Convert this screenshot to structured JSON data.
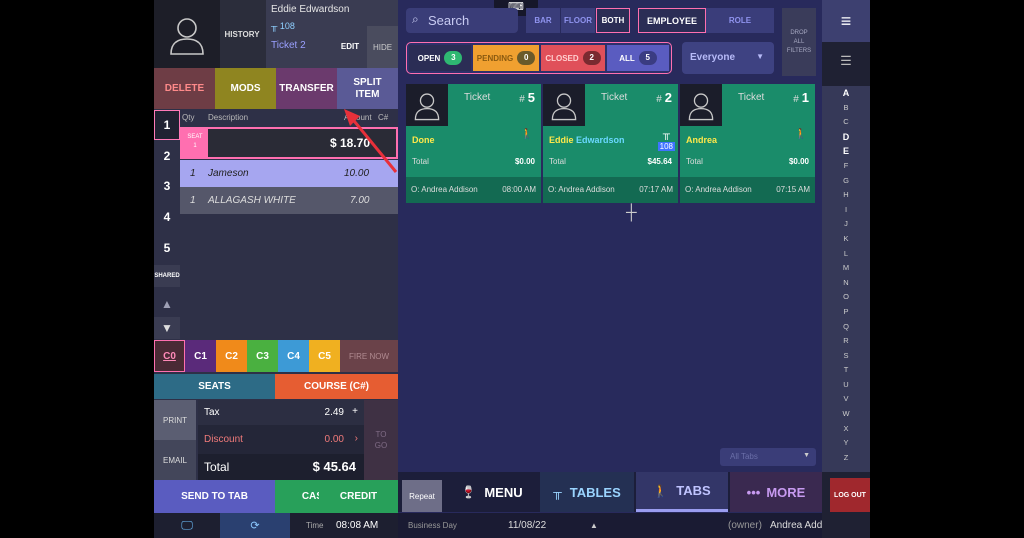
{
  "customer": {
    "history_label": "HISTORY",
    "name": "Eddie Edwardson",
    "table": "108",
    "ticket": "Ticket 2",
    "edit_label": "EDIT",
    "hide_label": "HIDE"
  },
  "actions": {
    "delete": "DELETE",
    "mods": "MODS",
    "transfer": "TRANSFER",
    "split_line1": "SPLIT",
    "split_line2": "ITEM"
  },
  "seats": [
    "1",
    "2",
    "3",
    "4",
    "5"
  ],
  "shared_label": "SHARED",
  "order_header": {
    "qty": "Qty",
    "description": "Description",
    "amount": "Amount",
    "course": "C#"
  },
  "seat_row": {
    "tag_line1": "SEAT",
    "tag_line2": "1",
    "total": "$ 18.70"
  },
  "items": [
    {
      "qty": "1",
      "name": "Jameson",
      "price": "10.00"
    },
    {
      "qty": "1",
      "name": "ALLAGASH WHITE",
      "price": "7.00"
    }
  ],
  "courses": [
    "C0",
    "C1",
    "C2",
    "C3",
    "C4",
    "C5"
  ],
  "course_colors": [
    "#2e3047",
    "#5a2a7a",
    "#f08a1a",
    "#4ab040",
    "#3d9ad6",
    "#f0b020"
  ],
  "fire_label": "FIRE NOW",
  "seats_btn": "SEATS",
  "course_btn": "COURSE (C#)",
  "print_label": "PRINT",
  "email_label": "EMAIL",
  "totals": {
    "tax_label": "Tax",
    "tax_value": "2.49",
    "discount_label": "Discount",
    "discount_value": "0.00",
    "total_label": "Total",
    "total_value": "$ 45.64"
  },
  "togo_line1": "TO",
  "togo_line2": "GO",
  "bottom_actions": {
    "send": "SEND TO TAB",
    "cash": "CASH",
    "credit": "CREDIT"
  },
  "status": {
    "time_label": "Time",
    "time_value": "08:08 AM"
  },
  "search": {
    "placeholder": "Search"
  },
  "area_filters": [
    "BAR",
    "FLOOR",
    "BOTH"
  ],
  "view_filters": [
    "EMPLOYEE",
    "ROLE"
  ],
  "drop_filters": {
    "l1": "DROP",
    "l2": "ALL",
    "l3": "FILTERS"
  },
  "status_filters": [
    {
      "label": "OPEN",
      "count": "3",
      "color": "#2fb872"
    },
    {
      "label": "PENDING",
      "count": "0",
      "color": "#6a5a2a"
    },
    {
      "label": "CLOSED",
      "count": "2",
      "color": "#7a2a30"
    },
    {
      "label": "ALL",
      "count": "5",
      "color": "#3a3c82"
    }
  ],
  "everyone_select": "Everyone",
  "tickets": [
    {
      "label": "Ticket",
      "num_prefix": "#",
      "number": "5",
      "name": "Done",
      "total_label": "Total",
      "total": "$0.00",
      "owner": "O: Andrea Addison",
      "time": "08:00 AM",
      "table": ""
    },
    {
      "label": "Ticket",
      "num_prefix": "#",
      "number": "2",
      "name": "Eddie Edwardson",
      "total_label": "Total",
      "total": "$45.64",
      "owner": "O: Andrea Addison",
      "time": "07:17 AM",
      "table": "108"
    },
    {
      "label": "Ticket",
      "num_prefix": "#",
      "number": "1",
      "name": "Andrea",
      "total_label": "Total",
      "total": "$0.00",
      "owner": "O: Andrea Addison",
      "time": "07:15 AM",
      "table": ""
    }
  ],
  "all_tabs": "All Tabs",
  "nav": {
    "repeat": "Repeat",
    "menu": "MENU",
    "tables": "TABLES",
    "tabs": "TABS",
    "more": "MORE"
  },
  "bizbar": {
    "label": "Business Day",
    "date": "11/08/22",
    "owner_label": "(owner)",
    "owner_name": "Andrea Addison"
  },
  "alphabet": [
    "A",
    "B",
    "C",
    "D",
    "E",
    "F",
    "G",
    "H",
    "I",
    "J",
    "K",
    "L",
    "M",
    "N",
    "O",
    "P",
    "Q",
    "R",
    "S",
    "T",
    "U",
    "V",
    "W",
    "X",
    "Y",
    "Z"
  ],
  "logout_label": "LOG OUT"
}
